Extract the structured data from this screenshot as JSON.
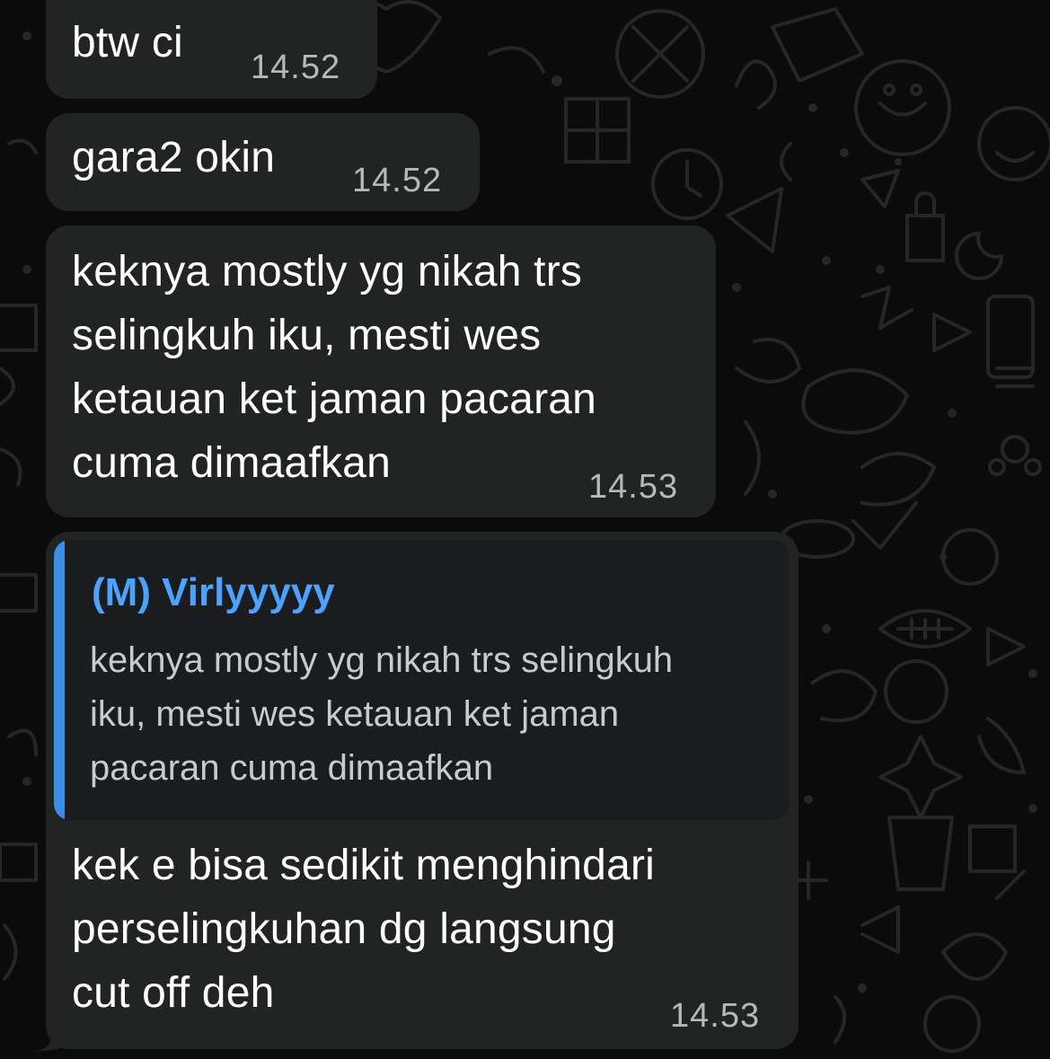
{
  "messages": [
    {
      "text": "btw ci",
      "time": "14.52"
    },
    {
      "text": "gara2 okin",
      "time": "14.52"
    },
    {
      "text_lines": [
        "keknya mostly yg nikah trs",
        "selingkuh iku, mesti wes",
        "ketauan ket jaman pacaran",
        "cuma dimaafkan"
      ],
      "time": "14.53"
    },
    {
      "reply": {
        "author": "(M) Virlyyyyy",
        "text_lines": [
          "keknya mostly yg nikah trs selingkuh",
          "iku, mesti wes ketauan ket jaman",
          "pacaran cuma dimaafkan"
        ]
      },
      "text_lines": [
        "kek e bisa sedikit menghindari",
        "perselingkuhan dg langsung",
        "cut off deh"
      ],
      "time": "14.53"
    }
  ],
  "colors": {
    "background": "#0b0b0b",
    "bubble": "#222323",
    "quote_bar": "#3a8ee6",
    "quote_author": "#4aa3ff"
  }
}
